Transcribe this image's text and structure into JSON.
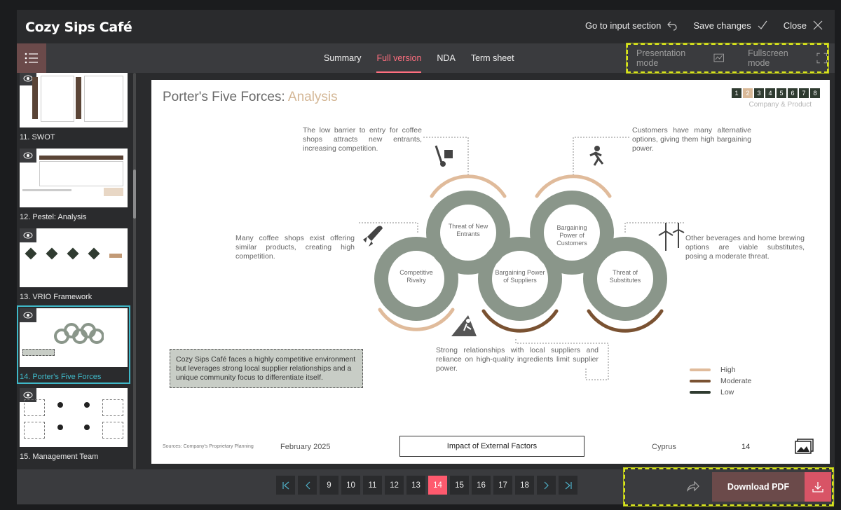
{
  "app": {
    "title": "Cozy Sips Café"
  },
  "top_actions": {
    "go_input": "Go to input section",
    "save": "Save changes",
    "close": "Close"
  },
  "tabs": [
    {
      "label": "Summary"
    },
    {
      "label": "Full version"
    },
    {
      "label": "NDA"
    },
    {
      "label": "Term sheet"
    }
  ],
  "modes": {
    "presentation": "Presentation mode",
    "fullscreen": "Fullscreen mode"
  },
  "sidebar": {
    "items": [
      {
        "label": "11. SWOT"
      },
      {
        "label": "12. Pestel: Analysis"
      },
      {
        "label": "13. VRIO Framework"
      },
      {
        "label": "14. Porter's Five Forces"
      },
      {
        "label": "15. Management Team"
      }
    ]
  },
  "slide": {
    "title_main": "Porter's Five Forces: ",
    "title_accent": "Analysis",
    "pager_numbers": [
      "1",
      "2",
      "3",
      "4",
      "5",
      "6",
      "7",
      "8"
    ],
    "pager_active": "2",
    "subtitle": "Company & Product",
    "texts": {
      "new_entrants": "The low barrier to entry for coffee shops attracts new entrants, increasing competition.",
      "customers": "Customers have many alternative options, giving them high bargaining power.",
      "rivalry": "Many coffee shops exist offering similar products, creating high competition.",
      "substitutes": "Other beverages and home brewing options are viable substitutes, posing a moderate threat.",
      "suppliers": "Strong relationships with local suppliers and reliance on high-quality ingredients limit supplier power."
    },
    "rings": {
      "rivalry": "Competitive Rivalry",
      "new_entrants": "Threat of New Entrants",
      "suppliers": "Bargaining Power of Suppliers",
      "customers": "Bargaining Power of Customers",
      "substitutes": "Threat of Substitutes"
    },
    "callout": "Cozy Sips Café faces a highly competitive environment but leverages strong local supplier relationships and a unique community focus to differentiate itself.",
    "legend": [
      {
        "label": "High",
        "color": "#e0bb9b"
      },
      {
        "label": "Moderate",
        "color": "#7a5232"
      },
      {
        "label": "Low",
        "color": "#2f3b30"
      }
    ],
    "footer": {
      "source": "Sources: Company's Proprietary Planning",
      "date": "February 2025",
      "box": "Impact of External Factors",
      "country": "Cyprus",
      "page": "14"
    }
  },
  "pagination": {
    "pages": [
      "9",
      "10",
      "11",
      "12",
      "13",
      "14",
      "15",
      "16",
      "17",
      "18"
    ],
    "active": "14"
  },
  "download": {
    "label": "Download PDF"
  },
  "colors": {
    "accent": "#ff5a6e",
    "brand_brown": "#6b4a4a",
    "ring_gray": "#8a968a",
    "teal": "#3fb8c8"
  }
}
